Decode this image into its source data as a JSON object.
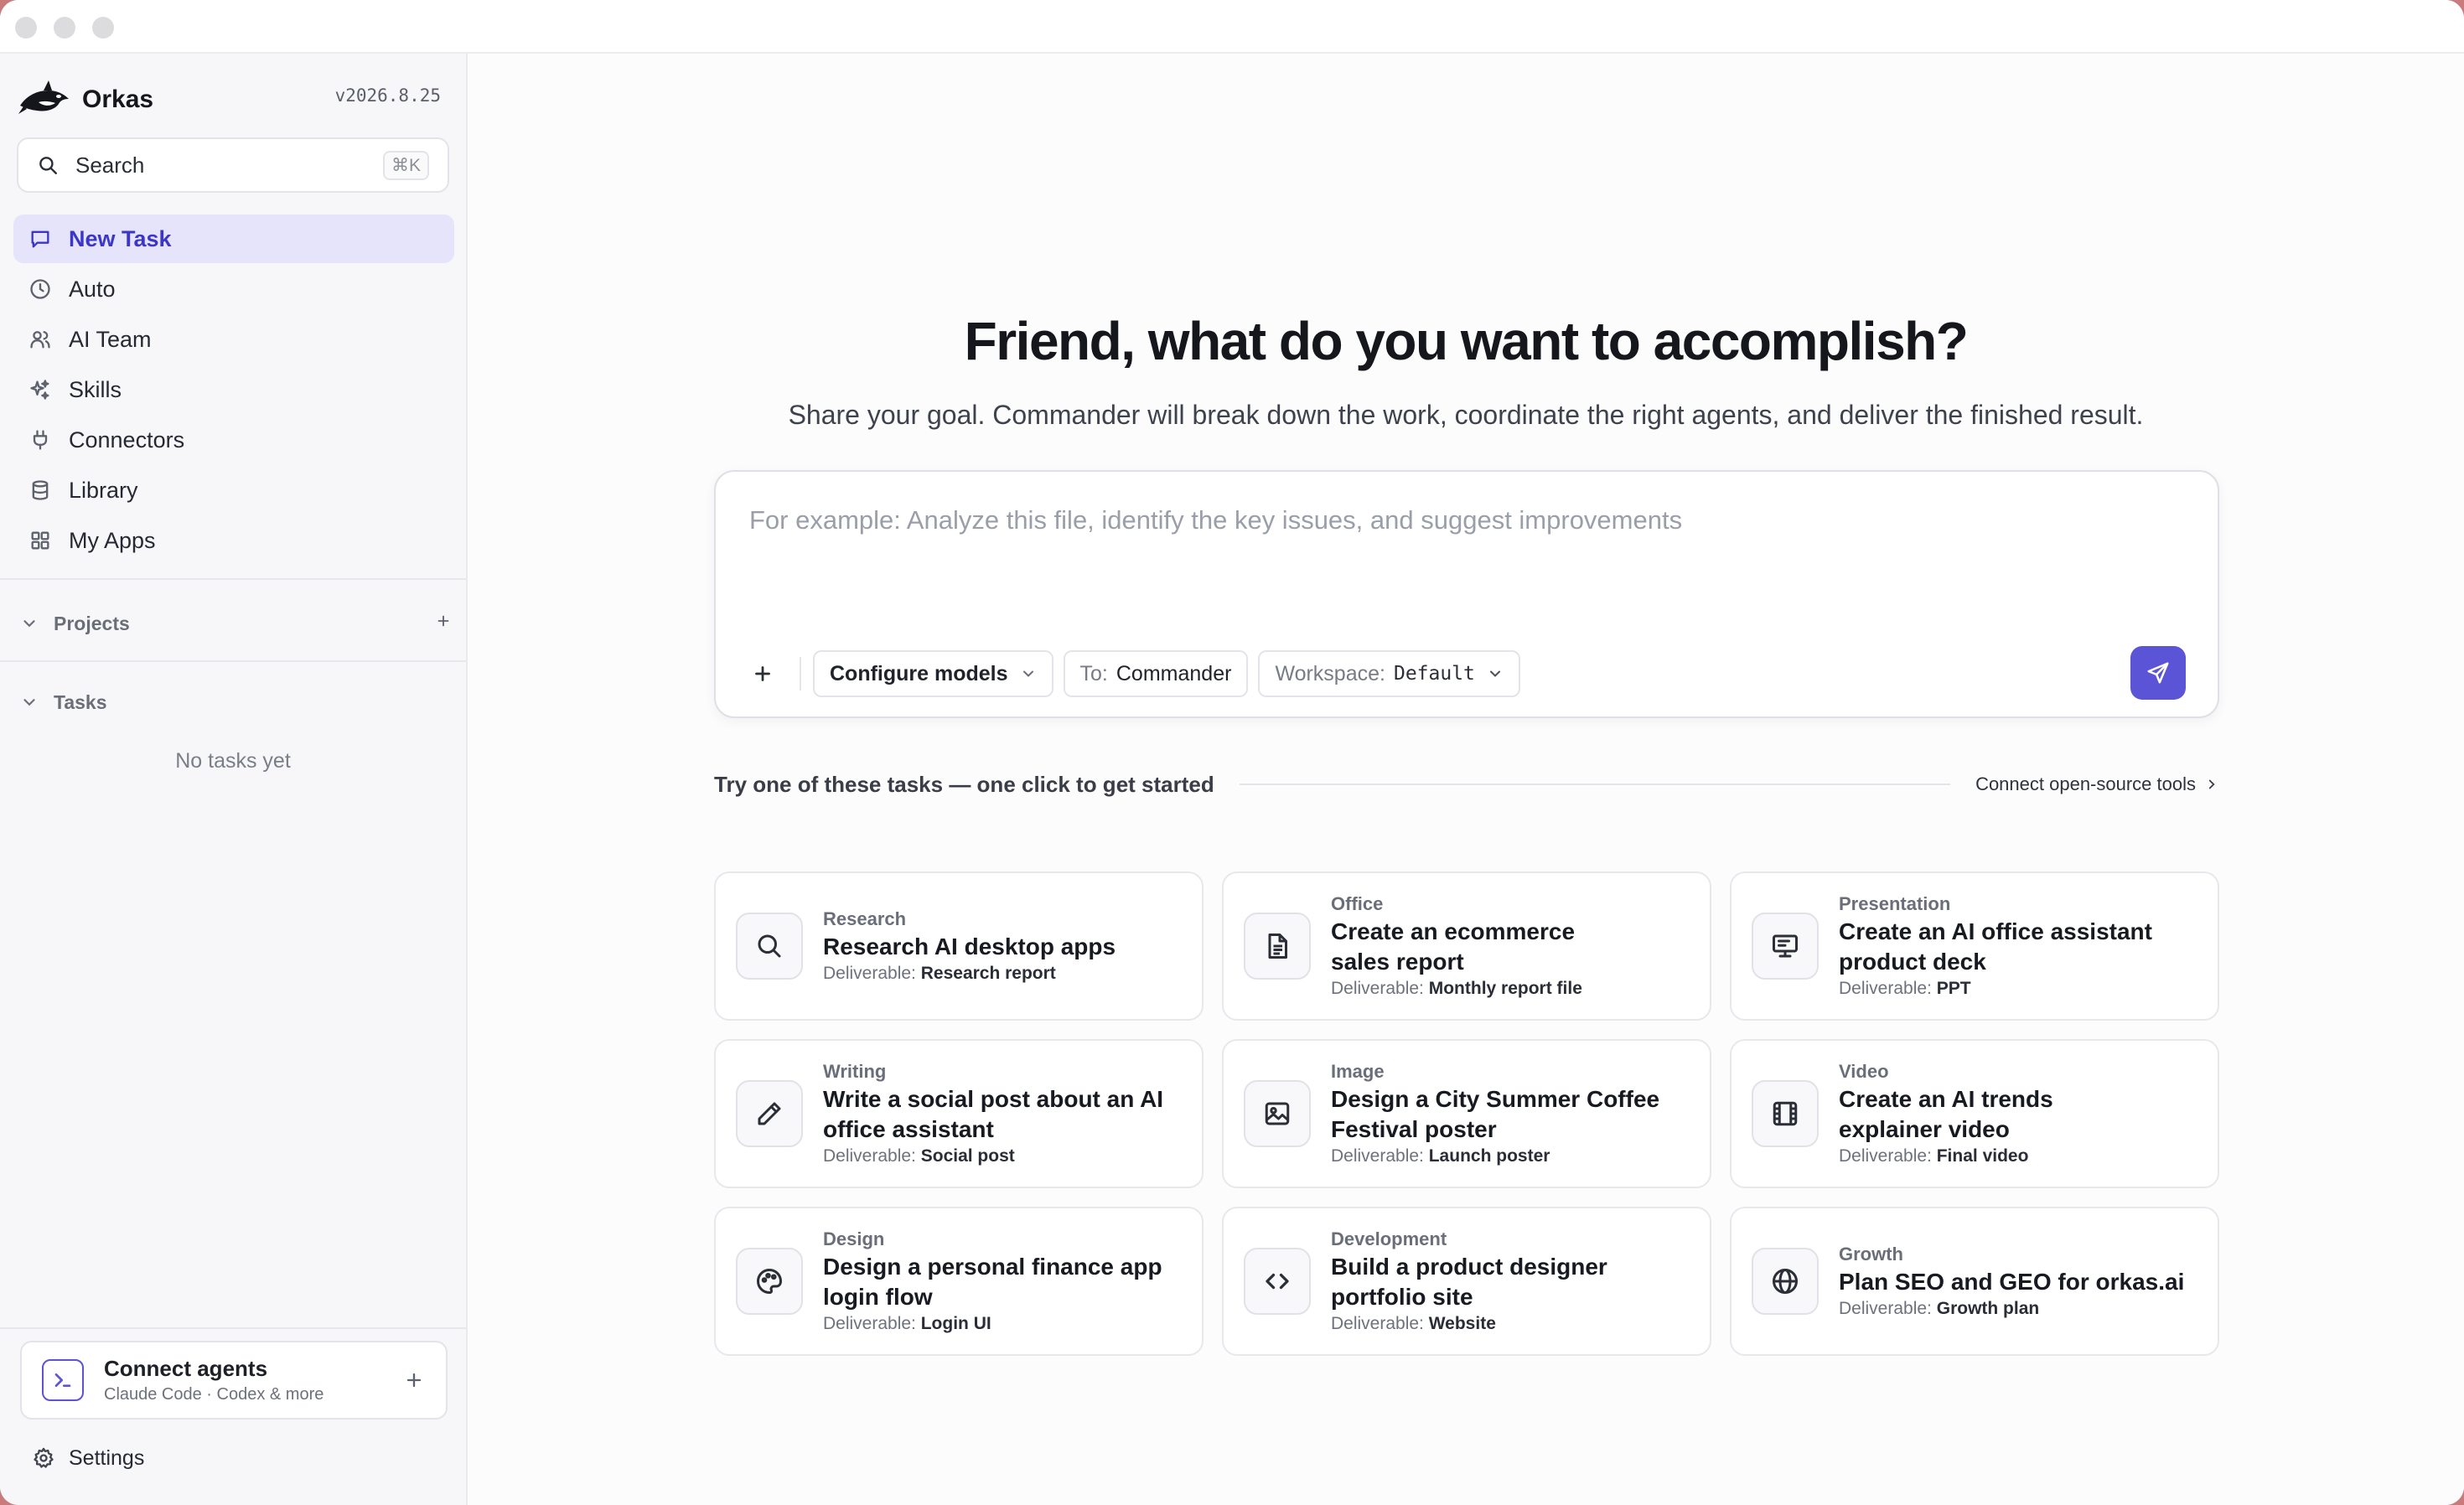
{
  "app": {
    "name": "Orkas",
    "version": "v2026.8.25"
  },
  "search": {
    "label": "Search",
    "shortcut": "⌘K"
  },
  "nav": [
    {
      "label": "New Task",
      "icon": "chat-bubble-icon",
      "active": true
    },
    {
      "label": "Auto",
      "icon": "clock-icon",
      "active": false
    },
    {
      "label": "AI Team",
      "icon": "users-icon",
      "active": false
    },
    {
      "label": "Skills",
      "icon": "sparkles-icon",
      "active": false
    },
    {
      "label": "Connectors",
      "icon": "plug-icon",
      "active": false
    },
    {
      "label": "Library",
      "icon": "database-icon",
      "active": false
    },
    {
      "label": "My Apps",
      "icon": "grid-icon",
      "active": false
    }
  ],
  "sections": {
    "projects": "Projects",
    "tasks": "Tasks",
    "no_tasks": "No tasks yet"
  },
  "connect": {
    "title": "Connect agents",
    "subtitle": "Claude Code · Codex & more"
  },
  "settings": {
    "label": "Settings"
  },
  "hero": {
    "title": "Friend, what do you want to accomplish?",
    "subtitle": "Share your goal. Commander will break down the work, coordinate the right agents, and deliver the finished result."
  },
  "composer": {
    "placeholder": "For example: Analyze this file, identify the key issues, and suggest improvements",
    "models_label": "Configure models",
    "to_prefix": "To:",
    "to_value": "Commander",
    "workspace_prefix": "Workspace:",
    "workspace_value": "Default"
  },
  "suggestions": {
    "heading": "Try one of these tasks — one click to get started",
    "link": "Connect open-source tools",
    "deliverable_prefix": "Deliverable:",
    "items": [
      {
        "category": "Research",
        "title": "Research AI desktop apps",
        "deliverable": "Research report",
        "icon": "search-icon"
      },
      {
        "category": "Office",
        "title": "Create an ecommerce sales report",
        "deliverable": "Monthly report file",
        "icon": "document-icon"
      },
      {
        "category": "Presentation",
        "title": "Create an AI office assistant product deck",
        "deliverable": "PPT",
        "icon": "presentation-icon"
      },
      {
        "category": "Writing",
        "title": "Write a social post about an AI office assistant",
        "deliverable": "Social post",
        "icon": "pencil-icon"
      },
      {
        "category": "Image",
        "title": "Design a City Summer Coffee Festival poster",
        "deliverable": "Launch poster",
        "icon": "image-icon"
      },
      {
        "category": "Video",
        "title": "Create an AI trends explainer video",
        "deliverable": "Final video",
        "icon": "film-icon"
      },
      {
        "category": "Design",
        "title": "Design a personal finance app login flow",
        "deliverable": "Login UI",
        "icon": "palette-icon"
      },
      {
        "category": "Development",
        "title": "Build a product designer portfolio site",
        "deliverable": "Website",
        "icon": "code-icon"
      },
      {
        "category": "Growth",
        "title": "Plan SEO and GEO for orkas.ai",
        "deliverable": "Growth plan",
        "icon": "globe-icon"
      }
    ]
  },
  "colors": {
    "accent": "#5b54d6",
    "active_nav_bg": "#e5e4fb",
    "active_nav_text": "#3c36c8"
  }
}
